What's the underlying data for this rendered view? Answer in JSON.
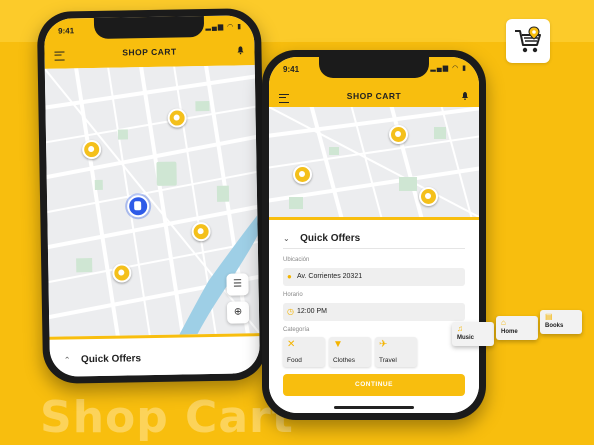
{
  "brand": {
    "watermark": "Shop Cart",
    "accent": "#F8BE0E",
    "logo_icon": "cart-pin-icon"
  },
  "phone1": {
    "time": "9:41",
    "status_icons": "▂▄▆ ◠ ▮",
    "title": "SHOP CART",
    "sheet_title": "Quick Offers",
    "map_buttons": [
      "filter-icon",
      "locate-icon"
    ]
  },
  "phone2": {
    "time": "9:41",
    "status_icons": "▂▄▆ ◠ ▮",
    "title": "SHOP CART",
    "sheet_title": "Quick Offers",
    "location_label": "Ubicación",
    "location_value": "Av. Corrientes 20321",
    "time_label": "Horario",
    "time_value": "12:00 PM",
    "category_label": "Categoría",
    "categories": [
      {
        "label": "Food",
        "icon": "fork-knife-icon"
      },
      {
        "label": "Clothes",
        "icon": "shirt-icon"
      },
      {
        "label": "Travel",
        "icon": "plane-icon"
      }
    ],
    "cta": "CONTINUE"
  },
  "floating_categories": [
    {
      "label": "Music",
      "icon": "headphones-icon"
    },
    {
      "label": "Home",
      "icon": "home-icon"
    },
    {
      "label": "Books",
      "icon": "book-icon"
    }
  ]
}
